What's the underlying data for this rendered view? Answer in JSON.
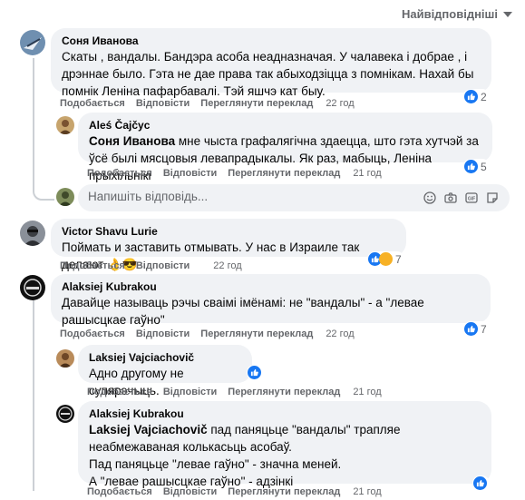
{
  "sort_label": "Найвідповідніші",
  "actions": {
    "like": "Подобається",
    "reply": "Відповісти",
    "translation": "Переглянути переклад"
  },
  "comments": [
    {
      "author": "Соня Иванова",
      "text": "Скаты , вандалы. Бандэра асоба неадназначая. У чалавека і добрае , і дрэннае было. Гэта не дае права так абыходзіцца з помнікам. Нахай бы помнік Леніна пафарбавалі. Тэй яшчэ кат быу.",
      "time": "22 год",
      "reactions": "2"
    },
    {
      "author": "Aleś Čajčyc",
      "mention": "Соня Иванова",
      "text": " мне чыста графалягічна здаецца, што гэта хутчэй за ўсё былі мясцовыя левапрадыкалы. Як раз, мабыць, Леніна прыхільнікі",
      "time": "21 год",
      "reactions": "5"
    },
    {
      "author": "Victor Shavu Lurie",
      "text": "Поймать и заставить отмывать. У нас в Израиле так делают",
      "emoji": "👌😎",
      "time": "22 год",
      "reactions": "7"
    },
    {
      "author": "Alaksiej Kubrakou",
      "text": "Давайце называць рэчы сваімі імёнамі: не \"вандалы\" - а \"левае рашысцкае гаўно\"",
      "time": "22 год",
      "reactions": "7"
    },
    {
      "author": "Laksiej Vajciachovič",
      "text": "Адно другому не супярэчыць.",
      "time": "21 год"
    },
    {
      "author": "Alaksiej Kubrakou",
      "mention": "Laksiej Vajciachovič",
      "text": " пад паняцьце \"вандалы\" трапляе неабмежаваная колькасьць асобаў.",
      "line2": "Пад паняцьце \"левае гаўно\" - значна меней.",
      "line3": "А \"левае рашысцкае гаўно\" - адзінкі",
      "time": "21 год"
    }
  ],
  "reply_placeholder": "Напишіть відповідь...",
  "colors": {
    "like_blue": "#1877f2",
    "bubble": "#f0f2f5",
    "meta": "#65676b"
  }
}
